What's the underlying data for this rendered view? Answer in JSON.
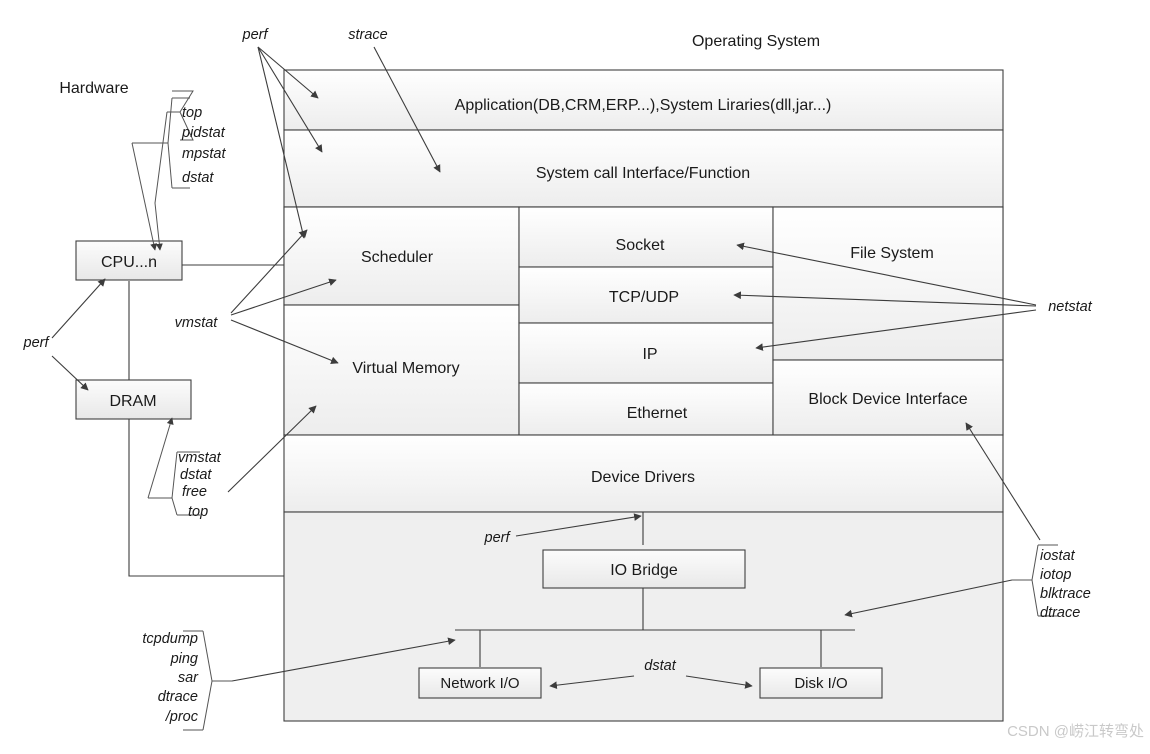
{
  "titles": {
    "operating_system": "Operating System",
    "hardware": "Hardware"
  },
  "os_stack": {
    "application_layer": "Application(DB,CRM,ERP...),System Liraries(dll,jar...)",
    "syscall_layer": "System call Interface/Function",
    "scheduler": "Scheduler",
    "virtual_memory": "Virtual Memory",
    "socket": "Socket",
    "tcp_udp": "TCP/UDP",
    "ip": "IP",
    "ethernet": "Ethernet",
    "file_system": "File System",
    "block_device_interface": "Block Device Interface",
    "device_drivers": "Device Drivers"
  },
  "io_blocks": {
    "io_bridge": "IO Bridge",
    "network_io": "Network I/O",
    "disk_io": "Disk I/O"
  },
  "hardware_blocks": {
    "cpu": "CPU...n",
    "dram": "DRAM"
  },
  "tools": {
    "perf_top": "perf",
    "strace": "strace",
    "cpu_group": [
      "top",
      "pidstat",
      "mpstat",
      "dstat"
    ],
    "perf_left": "perf",
    "vmstat": "vmstat",
    "dram_group": [
      "vmstat",
      "dstat",
      "free",
      "top"
    ],
    "netstat": "netstat",
    "iostat_group": [
      "iostat",
      "iotop",
      "blktrace",
      "dtrace"
    ],
    "tcpdump_group": [
      "tcpdump",
      "ping",
      "sar",
      "dtrace",
      "/proc"
    ],
    "perf_bridge": "perf",
    "dstat_io": "dstat"
  },
  "watermark": "CSDN @崂江转弯处",
  "colors": {
    "stroke": "#3f3f3f",
    "text": "#1a1a1a",
    "cell_fill_top": "#ffffff",
    "cell_fill_bottom": "#ebebeb",
    "watermark": "#c9c9c9"
  }
}
